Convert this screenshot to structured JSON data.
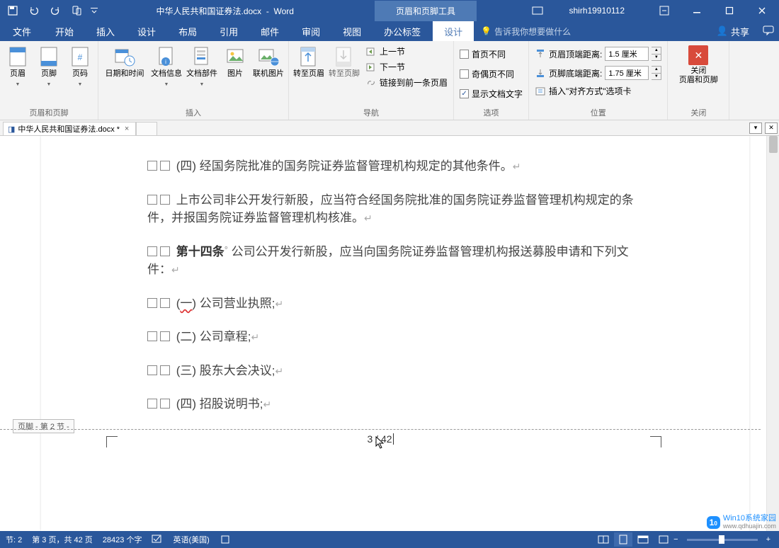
{
  "title_bar": {
    "doc_title": "中华人民共和国证券法.docx",
    "app_name": "Word",
    "contextual_tab_group": "页眉和页脚工具",
    "user": "shirh19910112"
  },
  "tabs": {
    "file": "文件",
    "home": "开始",
    "insert": "插入",
    "design": "设计",
    "layout": "布局",
    "references": "引用",
    "mailings": "邮件",
    "review": "审阅",
    "view": "视图",
    "office_tabs": "办公标签",
    "hf_design": "设计",
    "tellme": "告诉我你想要做什么",
    "share": "共享"
  },
  "ribbon": {
    "group_hf": {
      "label": "页眉和页脚",
      "header": "页眉",
      "footer": "页脚",
      "pagenum": "页码"
    },
    "group_insert": {
      "label": "插入",
      "datetime": "日期和时间",
      "docinfo": "文档信息",
      "docparts": "文档部件",
      "picture": "图片",
      "online_pic": "联机图片"
    },
    "group_nav": {
      "label": "导航",
      "goto_header": "转至页眉",
      "goto_footer": "转至页脚",
      "prev": "上一节",
      "next": "下一节",
      "link_prev": "链接到前一条页眉"
    },
    "group_options": {
      "label": "选项",
      "first_diff": "首页不同",
      "odd_even": "奇偶页不同",
      "show_doc": "显示文档文字"
    },
    "group_pos": {
      "label": "位置",
      "header_from_top": "页眉顶端距离:",
      "header_val": "1.5 厘米",
      "footer_from_bottom": "页脚底端距离:",
      "footer_val": "1.75 厘米",
      "insert_align": "插入\"对齐方式\"选项卡"
    },
    "group_close": {
      "label": "关闭",
      "close_hf": "关闭\n页眉和页脚"
    }
  },
  "doc_tab": {
    "name": "中华人民共和国证券法.docx *"
  },
  "document": {
    "p1": "(四) 经国务院批准的国务院证券监督管理机构规定的其他条件。",
    "p2": "上市公司非公开发行新股，应当符合经国务院批准的国务院证券监督管理机构规定的条件，并报国务院证券监督管理机构核准。",
    "p3_bold": "第十四条",
    "p3_rest": " 公司公开发行新股，应当向国务院证券监督管理机构报送募股申请和下列文件：",
    "p4_a": "(",
    "p4_wavy": "一",
    "p4_b": ") 公司营业执照;",
    "p5": "(二) 公司章程;",
    "p6": "(三) 股东大会决议;",
    "p7": "(四) 招股说明书;",
    "footer_tag": "页脚 - 第 2 节 -",
    "page_num": "3 / 42"
  },
  "status": {
    "section": "节: 2",
    "page": "第 3 页，共 42 页",
    "words": "28423 个字",
    "lang": "英语(美国)"
  },
  "watermark": {
    "brand": "Win10系统家园",
    "url": "www.qdhuajin.com"
  }
}
